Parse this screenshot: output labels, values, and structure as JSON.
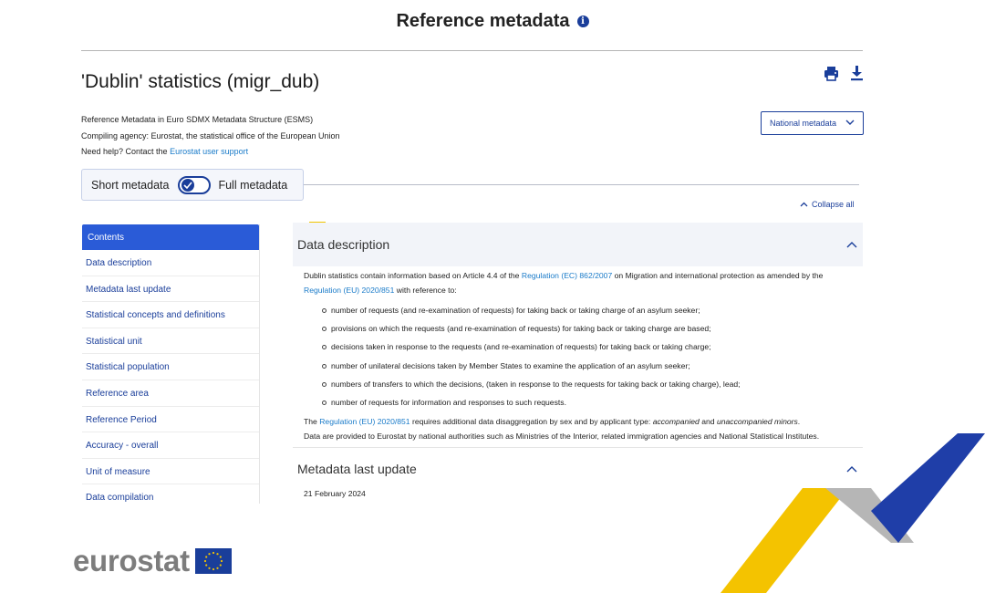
{
  "header": {
    "title": "Reference metadata",
    "info_icon": "info-circle-icon"
  },
  "dataset": {
    "title": "'Dublin' statistics (migr_dub)"
  },
  "toolbar": {
    "print_icon": "print-icon",
    "download_icon": "download-icon"
  },
  "meta": {
    "line1": "Reference Metadata in Euro SDMX Metadata Structure (ESMS)",
    "line2": "Compiling agency: Eurostat, the statistical office of the European Union",
    "help_prefix": "Need help? Contact the ",
    "help_link": "Eurostat user support"
  },
  "national_select": {
    "value": "National metadata"
  },
  "toggle": {
    "left_label": "Short metadata",
    "right_label": "Full metadata",
    "state": "full"
  },
  "collapse_all": {
    "label": "Collapse all"
  },
  "toc": {
    "heading": "Contents",
    "items": [
      "Data description",
      "Metadata last update",
      "Statistical concepts and definitions",
      "Statistical unit",
      "Statistical population",
      "Reference area",
      "Reference Period",
      "Accuracy - overall",
      "Unit of measure",
      "Data compilation"
    ]
  },
  "sections": {
    "data_description": {
      "title": "Data description",
      "intro_1": "Dublin statistics contain information based on Article 4.4 of the ",
      "intro_link_1": "Regulation (EC) 862/2007",
      "intro_2": " on Migration and international protection as amended by the ",
      "intro_link_2": "Regulation (EU) 2020/851",
      "intro_3": " with reference to:",
      "bullets": [
        "number of requests (and re-examination of requests) for taking back or taking charge of an asylum seeker;",
        "provisions on which the requests (and re-examination of requests) for taking back or taking charge are based;",
        "decisions taken in response to the requests (and re-examination of requests) for taking back or taking charge;",
        "number of unilateral decisions taken by Member States to examine the application of an asylum seeker;",
        "numbers of transfers to which the decisions, (taken in response to the requests for taking back or taking charge), lead;",
        "number of requests for information and responses to such requests."
      ],
      "para2_1": "The ",
      "para2_link": "Regulation (EU) 2020/851",
      "para2_2": " requires additional data disaggregation by sex and by applicant type: ",
      "para2_em1": "accompanied",
      "para2_3": " and ",
      "para2_em2": "unaccompanied minors",
      "para2_4": ".",
      "para3": "Data are provided to Eurostat by national authorities such as Ministries of the Interior, related immigration agencies and National Statistical Institutes."
    },
    "metadata_last_update": {
      "title": "Metadata last update",
      "date": "21 February 2024"
    }
  },
  "logo": {
    "text": "eurostat"
  },
  "colors": {
    "accent_blue": "#1a3e9a",
    "toc_blue": "#2a5bd7",
    "link_blue": "#1a7bc9",
    "yellow": "#f1c400"
  }
}
